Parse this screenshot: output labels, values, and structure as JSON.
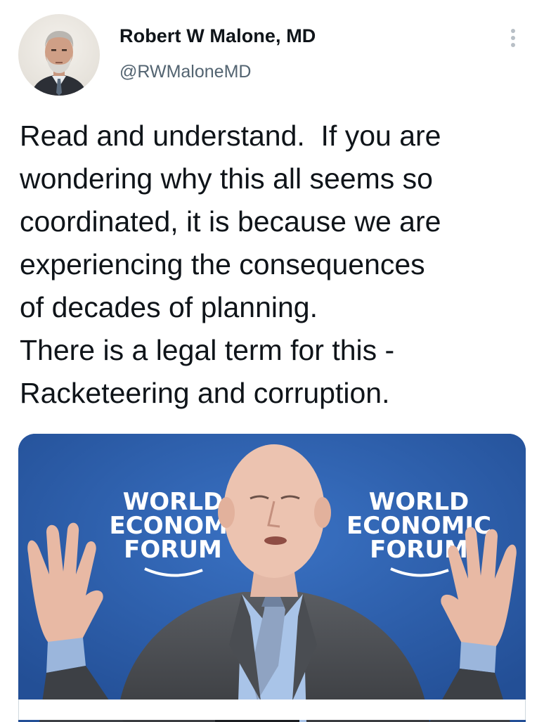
{
  "author": {
    "display_name": "Robert W Malone, MD",
    "handle": "@RWMaloneMD",
    "avatar_icon": "profile-photo"
  },
  "more_icon": "more-vertical-icon",
  "tweet": {
    "lines": [
      "Read and understand.  If you are",
      "wondering why this all seems so",
      "coordinated, it is because we are",
      "experiencing the consequences",
      "of decades of planning.",
      "There is a legal term for this -",
      "Racketeering and corruption."
    ]
  },
  "media": {
    "logo_left": [
      "WORLD",
      "ECONOMI",
      "FORUM"
    ],
    "logo_right": [
      "WORLD",
      "ECONOMIC",
      "FORUM"
    ],
    "background_color": "#2b5fae"
  },
  "colors": {
    "text": "#0f1419",
    "secondary": "#536471",
    "border": "#cfd9de"
  }
}
